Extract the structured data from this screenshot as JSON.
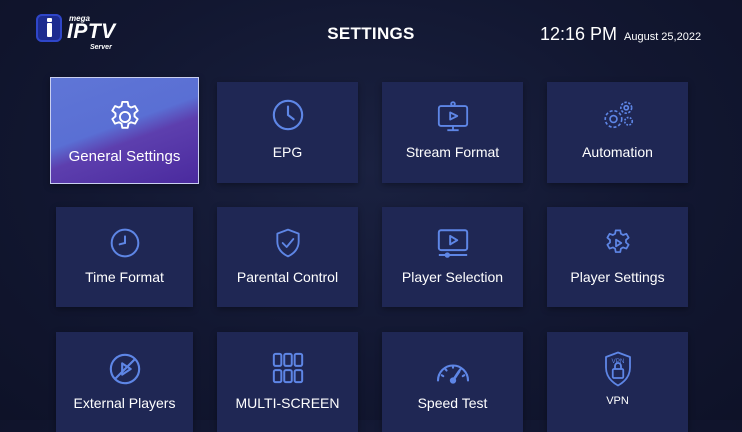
{
  "header": {
    "logo": {
      "prefix": "mega",
      "brand": "IPTV",
      "suffix": "Server"
    },
    "title": "SETTINGS",
    "time": "12:16 PM",
    "date": "August 25,2022"
  },
  "colors": {
    "background": "#141a36",
    "tile": "#1f2754",
    "tile_active_start": "#5f76d6",
    "tile_active_end": "#4a2a9e",
    "icon_stroke": "#5e86e6"
  },
  "tiles": [
    {
      "label": "General Settings",
      "icon": "gear-icon",
      "selected": true
    },
    {
      "label": "EPG",
      "icon": "clock-icon",
      "selected": false
    },
    {
      "label": "Stream Format",
      "icon": "monitor-play-icon",
      "selected": false
    },
    {
      "label": "Automation",
      "icon": "gears-icon",
      "selected": false
    },
    {
      "label": "Time Format",
      "icon": "clock-icon",
      "selected": false
    },
    {
      "label": "Parental Control",
      "icon": "shield-check-icon",
      "selected": false
    },
    {
      "label": "Player Selection",
      "icon": "player-screen-icon",
      "selected": false
    },
    {
      "label": "Player Settings",
      "icon": "gear-play-icon",
      "selected": false
    },
    {
      "label": "External Players",
      "icon": "no-play-icon",
      "selected": false
    },
    {
      "label": "MULTI-SCREEN",
      "icon": "grid-icon",
      "selected": false
    },
    {
      "label": "Speed Test",
      "icon": "speedometer-icon",
      "selected": false
    },
    {
      "label": "VPN",
      "icon": "vpn-shield-icon",
      "icon_text": "VPN",
      "selected": false
    }
  ]
}
